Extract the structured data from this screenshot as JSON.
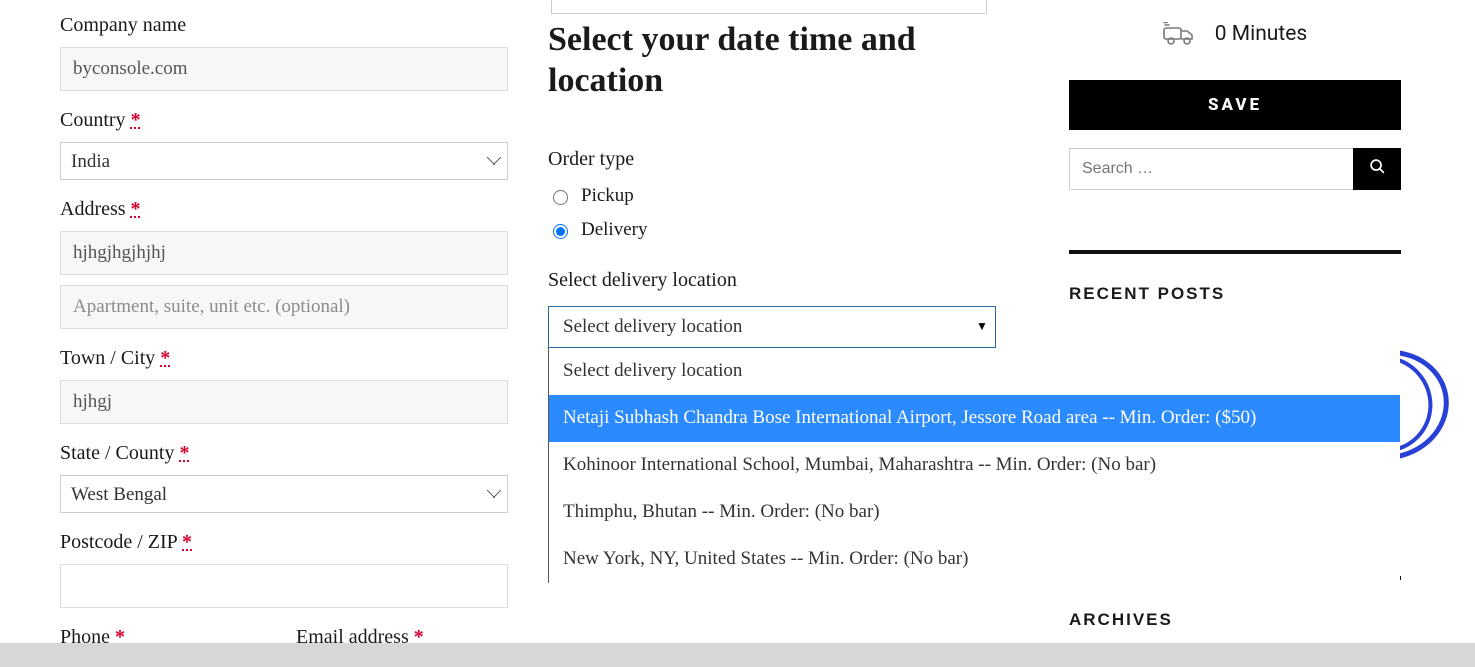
{
  "form": {
    "company": {
      "label": "Company name",
      "value": "byconsole.com"
    },
    "country": {
      "label": "Country",
      "value": "India"
    },
    "address": {
      "label": "Address",
      "value": "hjhgjhgjhjhj",
      "placeholder2": "Apartment, suite, unit etc. (optional)"
    },
    "city": {
      "label": "Town / City",
      "value": "hjhgj"
    },
    "state": {
      "label": "State / County",
      "value": "West Bengal"
    },
    "postcode": {
      "label": "Postcode / ZIP",
      "value": ""
    },
    "phone": {
      "label": "Phone"
    },
    "email": {
      "label": "Email address"
    }
  },
  "center": {
    "headline": "Select your date time and location",
    "order_type": {
      "label": "Order type",
      "pickup": "Pickup",
      "delivery": "Delivery"
    },
    "loc_label": "Select delivery location",
    "dd_selected": "Select delivery location",
    "dd_options": {
      "o0": "Select delivery location",
      "o1": "Netaji Subhash Chandra Bose International Airport, Jessore Road area  --   Min. Order: ($50)",
      "o2": "Kohinoor International School, Mumbai, Maharashtra  --   Min. Order: (No bar)",
      "o3": "Thimphu, Bhutan  --   Min. Order: (No bar)",
      "o4": "New York, NY, United States  --   Min. Order: (No bar)"
    }
  },
  "sidebar": {
    "minutes": "0 Minutes",
    "save": "SAVE",
    "search_placeholder": "Search …",
    "recent": "RECENT POSTS",
    "archives": "ARCHIVES"
  }
}
